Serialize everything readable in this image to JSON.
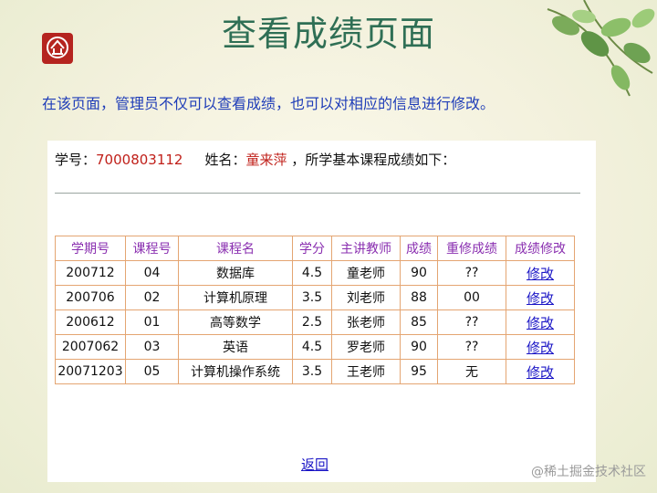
{
  "slide_title": "查看成绩页面",
  "subtitle": "在该页面，管理员不仅可以查看成绩，也可以对相应的信息进行修改。",
  "student": {
    "id_label": "学号：",
    "id_value": "7000803112",
    "name_label": "姓名：",
    "name_value": "童来萍",
    "summary": "，所学基本课程成绩如下："
  },
  "table": {
    "headers": [
      "学期号",
      "课程号",
      "课程名",
      "学分",
      "主讲教师",
      "成绩",
      "重修成绩",
      "成绩修改"
    ],
    "rows": [
      [
        "200712",
        "04",
        "数据库",
        "4.5",
        "童老师",
        "90",
        "??",
        "修改"
      ],
      [
        "200706",
        "02",
        "计算机原理",
        "3.5",
        "刘老师",
        "88",
        "00",
        "修改"
      ],
      [
        "200612",
        "01",
        "高等数学",
        "2.5",
        "张老师",
        "85",
        "??",
        "修改"
      ],
      [
        "2007062",
        "03",
        "英语",
        "4.5",
        "罗老师",
        "90",
        "??",
        "修改"
      ],
      [
        "20071203",
        "05",
        "计算机操作系统",
        "3.5",
        "王老师",
        "95",
        "无",
        "修改"
      ]
    ]
  },
  "back_link": "返回",
  "watermark": "@稀土掘金技术社区",
  "colors": {
    "title": "#2f6f55",
    "subtitle": "#1f3db8",
    "highlight": "#c0201a",
    "link": "#1b16c6",
    "header": "#8a2fb0",
    "border": "#e4a572"
  }
}
